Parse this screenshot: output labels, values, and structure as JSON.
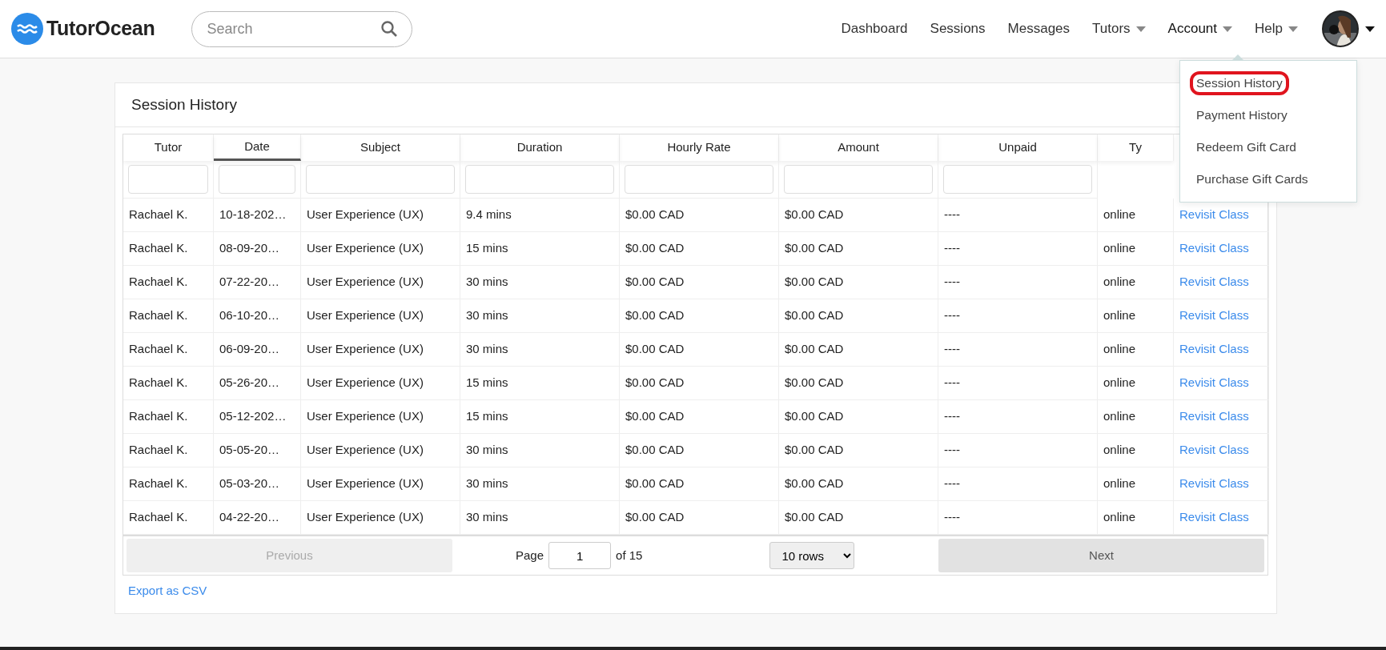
{
  "header": {
    "logo": "TutorOcean",
    "search": {
      "placeholder": "Search"
    },
    "nav": [
      {
        "label": "Dashboard",
        "dropdown": false,
        "selected": false
      },
      {
        "label": "Sessions",
        "dropdown": false,
        "selected": false
      },
      {
        "label": "Messages",
        "dropdown": false,
        "selected": false
      },
      {
        "label": "Tutors",
        "dropdown": true,
        "selected": false
      },
      {
        "label": "Account",
        "dropdown": true,
        "selected": true
      },
      {
        "label": "Help",
        "dropdown": true,
        "selected": false
      }
    ],
    "account_menu": [
      {
        "label": "Session History",
        "highlighted": true
      },
      {
        "label": "Payment History",
        "highlighted": false
      },
      {
        "label": "Redeem Gift Card",
        "highlighted": false
      },
      {
        "label": "Purchase Gift Cards",
        "highlighted": false
      }
    ]
  },
  "card": {
    "title": "Session History",
    "table": {
      "columns": [
        {
          "label": "Tutor",
          "sorted": false,
          "filter": true
        },
        {
          "label": "Date",
          "sorted": true,
          "filter": true
        },
        {
          "label": "Subject",
          "sorted": false,
          "filter": true
        },
        {
          "label": "Duration",
          "sorted": false,
          "filter": true
        },
        {
          "label": "Hourly Rate",
          "sorted": false,
          "filter": true
        },
        {
          "label": "Amount",
          "sorted": false,
          "filter": true
        },
        {
          "label": "Unpaid",
          "sorted": false,
          "filter": true
        },
        {
          "label": "Ty",
          "sorted": false,
          "filter": false
        }
      ],
      "rows": [
        [
          "Rachael K.",
          "10-18-202…",
          "User Experience (UX)",
          "9.4 mins",
          "$0.00 CAD",
          "$0.00 CAD",
          "----",
          "online",
          "Revisit Class"
        ],
        [
          "Rachael K.",
          "08-09-20…",
          "User Experience (UX)",
          "15 mins",
          "$0.00 CAD",
          "$0.00 CAD",
          "----",
          "online",
          "Revisit Class"
        ],
        [
          "Rachael K.",
          "07-22-20…",
          "User Experience (UX)",
          "30 mins",
          "$0.00 CAD",
          "$0.00 CAD",
          "----",
          "online",
          "Revisit Class"
        ],
        [
          "Rachael K.",
          "06-10-20…",
          "User Experience (UX)",
          "30 mins",
          "$0.00 CAD",
          "$0.00 CAD",
          "----",
          "online",
          "Revisit Class"
        ],
        [
          "Rachael K.",
          "06-09-20…",
          "User Experience (UX)",
          "30 mins",
          "$0.00 CAD",
          "$0.00 CAD",
          "----",
          "online",
          "Revisit Class"
        ],
        [
          "Rachael K.",
          "05-26-20…",
          "User Experience (UX)",
          "15 mins",
          "$0.00 CAD",
          "$0.00 CAD",
          "----",
          "online",
          "Revisit Class"
        ],
        [
          "Rachael K.",
          "05-12-202…",
          "User Experience (UX)",
          "15 mins",
          "$0.00 CAD",
          "$0.00 CAD",
          "----",
          "online",
          "Revisit Class"
        ],
        [
          "Rachael K.",
          "05-05-20…",
          "User Experience (UX)",
          "30 mins",
          "$0.00 CAD",
          "$0.00 CAD",
          "----",
          "online",
          "Revisit Class"
        ],
        [
          "Rachael K.",
          "05-03-20…",
          "User Experience (UX)",
          "30 mins",
          "$0.00 CAD",
          "$0.00 CAD",
          "----",
          "online",
          "Revisit Class"
        ],
        [
          "Rachael K.",
          "04-22-20…",
          "User Experience (UX)",
          "30 mins",
          "$0.00 CAD",
          "$0.00 CAD",
          "----",
          "online",
          "Revisit Class"
        ]
      ]
    },
    "pagination": {
      "previous": {
        "label": "Previous",
        "disabled": true
      },
      "page_label": "Page",
      "page": "1",
      "of": "of 15",
      "rows_select": "10 rows",
      "next": {
        "label": "Next",
        "disabled": false
      }
    },
    "export_link": "Export as CSV"
  }
}
